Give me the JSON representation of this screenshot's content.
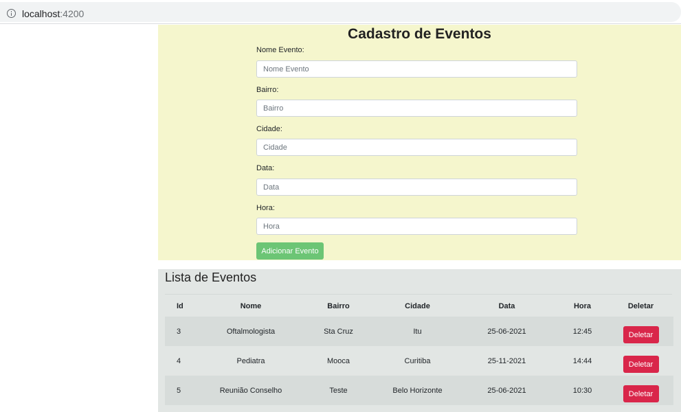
{
  "browser": {
    "url_host": "localhost",
    "url_port": ":4200"
  },
  "form": {
    "title": "Cadastro de Eventos",
    "fields": [
      {
        "label": "Nome Evento:",
        "placeholder": "Nome Evento"
      },
      {
        "label": "Bairro:",
        "placeholder": "Bairro"
      },
      {
        "label": "Cidade:",
        "placeholder": "Cidade"
      },
      {
        "label": "Data:",
        "placeholder": "Data"
      },
      {
        "label": "Hora:",
        "placeholder": "Hora"
      }
    ],
    "submit_label": "Adicionar Evento"
  },
  "list": {
    "title": "Lista de Eventos",
    "headers": [
      "Id",
      "Nome",
      "Bairro",
      "Cidade",
      "Data",
      "Hora",
      "Deletar"
    ],
    "rows": [
      {
        "id": "3",
        "nome": "Oftalmologista",
        "bairro": "Sta Cruz",
        "cidade": "Itu",
        "data": "25-06-2021",
        "hora": "12:45",
        "action": "Deletar"
      },
      {
        "id": "4",
        "nome": "Pediatra",
        "bairro": "Mooca",
        "cidade": "Curitiba",
        "data": "25-11-2021",
        "hora": "14:44",
        "action": "Deletar"
      },
      {
        "id": "5",
        "nome": "Reunião Conselho",
        "bairro": "Teste",
        "cidade": "Belo Horizonte",
        "data": "25-06-2021",
        "hora": "10:30",
        "action": "Deletar"
      }
    ]
  },
  "colors": {
    "form_bg": "#f5f6cd",
    "list_bg": "#e2e6e4",
    "submit_btn": "#6cc575",
    "delete_btn": "#d9264a"
  }
}
